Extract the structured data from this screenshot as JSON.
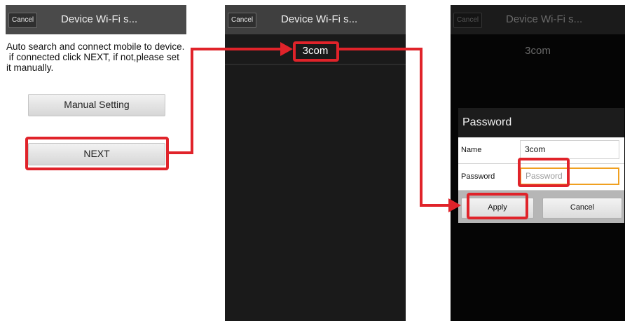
{
  "colors": {
    "annotation": "#e0232a",
    "accent_field": "#f0a020"
  },
  "screen1": {
    "cancel_label": "Cancel",
    "title": "Device Wi-Fi s...",
    "description": "Auto search and connect mobile to device.\n if connected click NEXT, if not,please set it manually.",
    "manual_setting_label": "Manual Setting",
    "next_label": "NEXT"
  },
  "screen2": {
    "cancel_label": "Cancel",
    "title": "Device Wi-Fi s...",
    "network_name": "3com"
  },
  "screen3": {
    "cancel_label": "Cancel",
    "title": "Device Wi-Fi s...",
    "network_name": "3com",
    "dialog": {
      "title": "Password",
      "name_label": "Name",
      "name_value": "3com",
      "password_label": "Password",
      "password_placeholder": "Password",
      "apply_label": "Apply",
      "cancel_label": "Cancel"
    }
  }
}
